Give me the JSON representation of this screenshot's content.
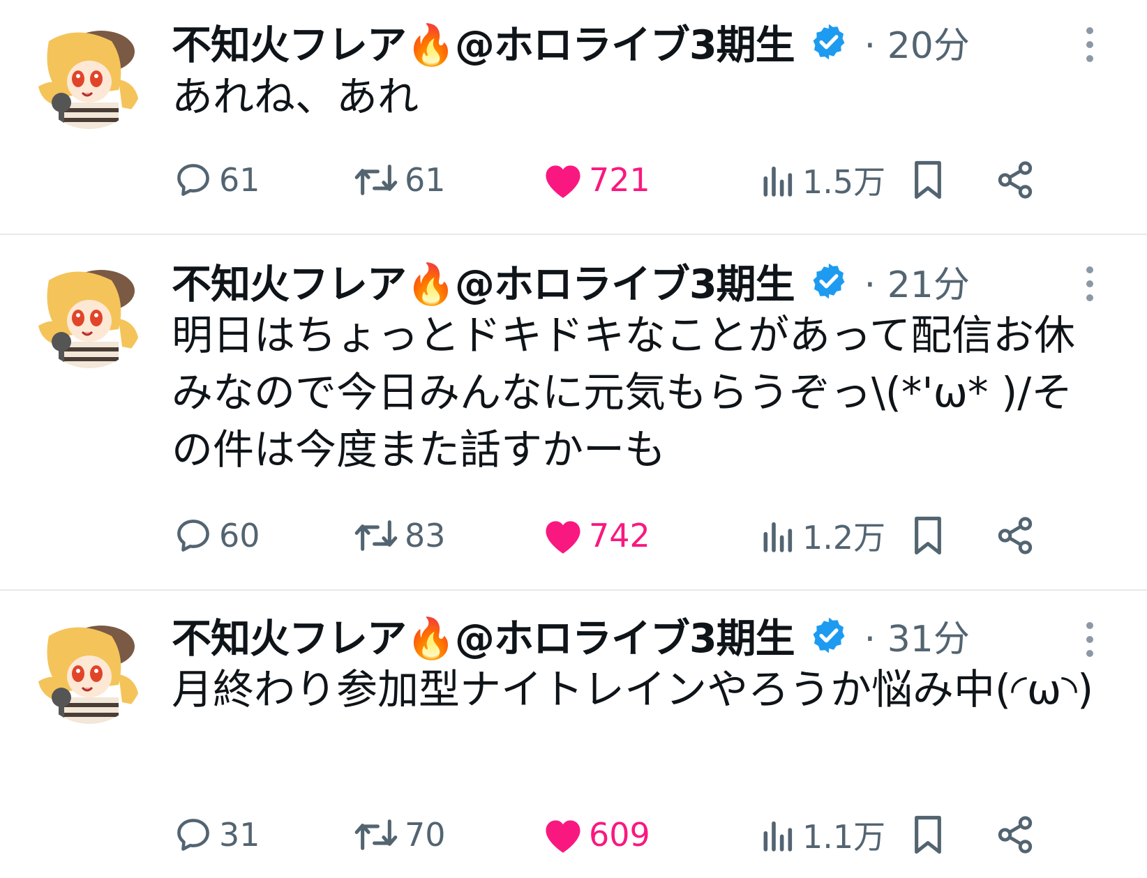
{
  "tweets": [
    {
      "name": "不知火フレア🔥@ホロライブ3期生",
      "time": "· 20分",
      "text": "あれね、あれ",
      "replies": "61",
      "retweets": "61",
      "likes": "721",
      "views": "1.5万"
    },
    {
      "name": "不知火フレア🔥@ホロライブ3期生",
      "time": "· 21分",
      "text": "明日はちょっとドキドキなことがあって配信お休みなので今日みんなに元気もらうぞっ\\(*'ω* )/その件は今度また話すかーも",
      "replies": "60",
      "retweets": "83",
      "likes": "742",
      "views": "1.2万"
    },
    {
      "name": "不知火フレア🔥@ホロライブ3期生",
      "time": "· 31分",
      "text": "月終わり参加型ナイトレインやろうか悩み中(◜ω◝)",
      "replies": "31",
      "retweets": "70",
      "likes": "609",
      "views": "1.1万"
    }
  ],
  "colors": {
    "text": "#0f1419",
    "secondary": "#536471",
    "like": "#f91880",
    "verified": "#1d9bf0",
    "divider": "#e6e8ea"
  },
  "icons": [
    "reply-icon",
    "retweet-icon",
    "like-icon",
    "views-icon",
    "bookmark-icon",
    "share-icon",
    "more-icon",
    "verified-badge-icon"
  ]
}
